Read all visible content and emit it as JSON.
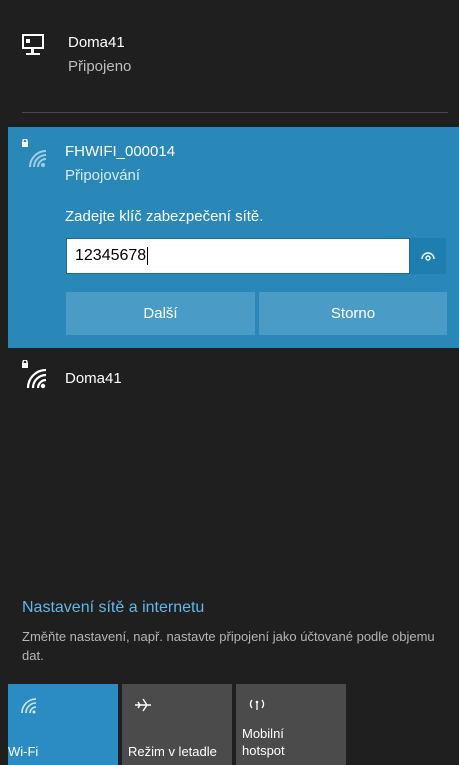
{
  "ethernet": {
    "name": "Doma41",
    "status": "Připojeno",
    "icon": "ethernet-icon"
  },
  "connecting_network": {
    "name": "FHWIFI_000014",
    "status": "Připojování",
    "prompt": "Zadejte klíč zabezpečení sítě.",
    "key_value": "12345678",
    "next_label": "Další",
    "cancel_label": "Storno",
    "icon": "wifi-secured-icon",
    "reveal_icon": "eye-icon"
  },
  "networks": [
    {
      "name": "Doma41",
      "icon": "wifi-secured-icon"
    }
  ],
  "settings": {
    "link": "Nastavení sítě a internetu",
    "description": "Změňte nastavení, např. nastavte připojení jako účtované podle objemu dat."
  },
  "tiles": {
    "wifi": {
      "label": "Wi-Fi",
      "icon": "wifi-icon"
    },
    "airplane": {
      "label": "Režim v letadle",
      "icon": "airplane-icon"
    },
    "hotspot": {
      "label_line1": "Mobilní",
      "label_line2": "hotspot",
      "icon": "hotspot-icon"
    }
  },
  "colors": {
    "accent": "#2a88b8",
    "link": "#5fb8e8",
    "background": "#1f1f1f"
  }
}
